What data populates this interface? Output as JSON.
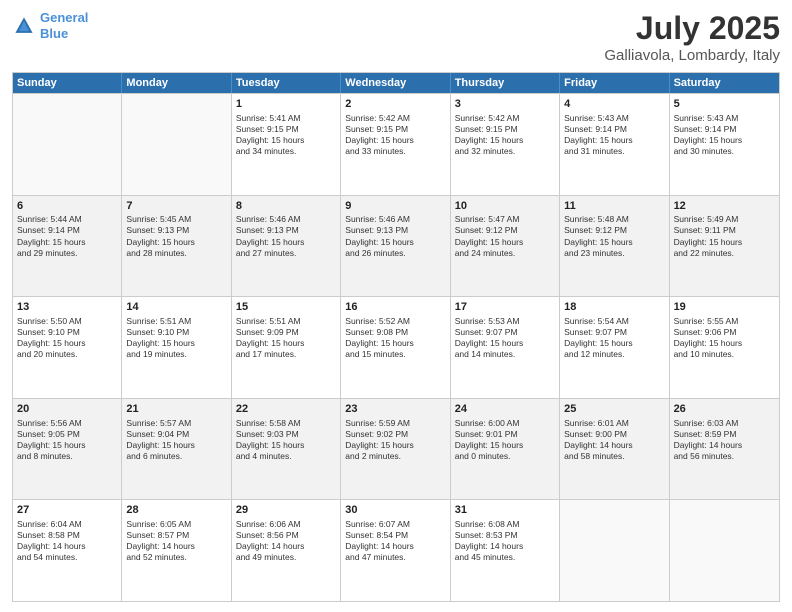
{
  "header": {
    "logo_line1": "General",
    "logo_line2": "Blue",
    "month": "July 2025",
    "location": "Galliavola, Lombardy, Italy"
  },
  "days_of_week": [
    "Sunday",
    "Monday",
    "Tuesday",
    "Wednesday",
    "Thursday",
    "Friday",
    "Saturday"
  ],
  "weeks": [
    [
      {
        "day": "",
        "info": ""
      },
      {
        "day": "",
        "info": ""
      },
      {
        "day": "1",
        "info": "Sunrise: 5:41 AM\nSunset: 9:15 PM\nDaylight: 15 hours\nand 34 minutes."
      },
      {
        "day": "2",
        "info": "Sunrise: 5:42 AM\nSunset: 9:15 PM\nDaylight: 15 hours\nand 33 minutes."
      },
      {
        "day": "3",
        "info": "Sunrise: 5:42 AM\nSunset: 9:15 PM\nDaylight: 15 hours\nand 32 minutes."
      },
      {
        "day": "4",
        "info": "Sunrise: 5:43 AM\nSunset: 9:14 PM\nDaylight: 15 hours\nand 31 minutes."
      },
      {
        "day": "5",
        "info": "Sunrise: 5:43 AM\nSunset: 9:14 PM\nDaylight: 15 hours\nand 30 minutes."
      }
    ],
    [
      {
        "day": "6",
        "info": "Sunrise: 5:44 AM\nSunset: 9:14 PM\nDaylight: 15 hours\nand 29 minutes."
      },
      {
        "day": "7",
        "info": "Sunrise: 5:45 AM\nSunset: 9:13 PM\nDaylight: 15 hours\nand 28 minutes."
      },
      {
        "day": "8",
        "info": "Sunrise: 5:46 AM\nSunset: 9:13 PM\nDaylight: 15 hours\nand 27 minutes."
      },
      {
        "day": "9",
        "info": "Sunrise: 5:46 AM\nSunset: 9:13 PM\nDaylight: 15 hours\nand 26 minutes."
      },
      {
        "day": "10",
        "info": "Sunrise: 5:47 AM\nSunset: 9:12 PM\nDaylight: 15 hours\nand 24 minutes."
      },
      {
        "day": "11",
        "info": "Sunrise: 5:48 AM\nSunset: 9:12 PM\nDaylight: 15 hours\nand 23 minutes."
      },
      {
        "day": "12",
        "info": "Sunrise: 5:49 AM\nSunset: 9:11 PM\nDaylight: 15 hours\nand 22 minutes."
      }
    ],
    [
      {
        "day": "13",
        "info": "Sunrise: 5:50 AM\nSunset: 9:10 PM\nDaylight: 15 hours\nand 20 minutes."
      },
      {
        "day": "14",
        "info": "Sunrise: 5:51 AM\nSunset: 9:10 PM\nDaylight: 15 hours\nand 19 minutes."
      },
      {
        "day": "15",
        "info": "Sunrise: 5:51 AM\nSunset: 9:09 PM\nDaylight: 15 hours\nand 17 minutes."
      },
      {
        "day": "16",
        "info": "Sunrise: 5:52 AM\nSunset: 9:08 PM\nDaylight: 15 hours\nand 15 minutes."
      },
      {
        "day": "17",
        "info": "Sunrise: 5:53 AM\nSunset: 9:07 PM\nDaylight: 15 hours\nand 14 minutes."
      },
      {
        "day": "18",
        "info": "Sunrise: 5:54 AM\nSunset: 9:07 PM\nDaylight: 15 hours\nand 12 minutes."
      },
      {
        "day": "19",
        "info": "Sunrise: 5:55 AM\nSunset: 9:06 PM\nDaylight: 15 hours\nand 10 minutes."
      }
    ],
    [
      {
        "day": "20",
        "info": "Sunrise: 5:56 AM\nSunset: 9:05 PM\nDaylight: 15 hours\nand 8 minutes."
      },
      {
        "day": "21",
        "info": "Sunrise: 5:57 AM\nSunset: 9:04 PM\nDaylight: 15 hours\nand 6 minutes."
      },
      {
        "day": "22",
        "info": "Sunrise: 5:58 AM\nSunset: 9:03 PM\nDaylight: 15 hours\nand 4 minutes."
      },
      {
        "day": "23",
        "info": "Sunrise: 5:59 AM\nSunset: 9:02 PM\nDaylight: 15 hours\nand 2 minutes."
      },
      {
        "day": "24",
        "info": "Sunrise: 6:00 AM\nSunset: 9:01 PM\nDaylight: 15 hours\nand 0 minutes."
      },
      {
        "day": "25",
        "info": "Sunrise: 6:01 AM\nSunset: 9:00 PM\nDaylight: 14 hours\nand 58 minutes."
      },
      {
        "day": "26",
        "info": "Sunrise: 6:03 AM\nSunset: 8:59 PM\nDaylight: 14 hours\nand 56 minutes."
      }
    ],
    [
      {
        "day": "27",
        "info": "Sunrise: 6:04 AM\nSunset: 8:58 PM\nDaylight: 14 hours\nand 54 minutes."
      },
      {
        "day": "28",
        "info": "Sunrise: 6:05 AM\nSunset: 8:57 PM\nDaylight: 14 hours\nand 52 minutes."
      },
      {
        "day": "29",
        "info": "Sunrise: 6:06 AM\nSunset: 8:56 PM\nDaylight: 14 hours\nand 49 minutes."
      },
      {
        "day": "30",
        "info": "Sunrise: 6:07 AM\nSunset: 8:54 PM\nDaylight: 14 hours\nand 47 minutes."
      },
      {
        "day": "31",
        "info": "Sunrise: 6:08 AM\nSunset: 8:53 PM\nDaylight: 14 hours\nand 45 minutes."
      },
      {
        "day": "",
        "info": ""
      },
      {
        "day": "",
        "info": ""
      }
    ]
  ]
}
